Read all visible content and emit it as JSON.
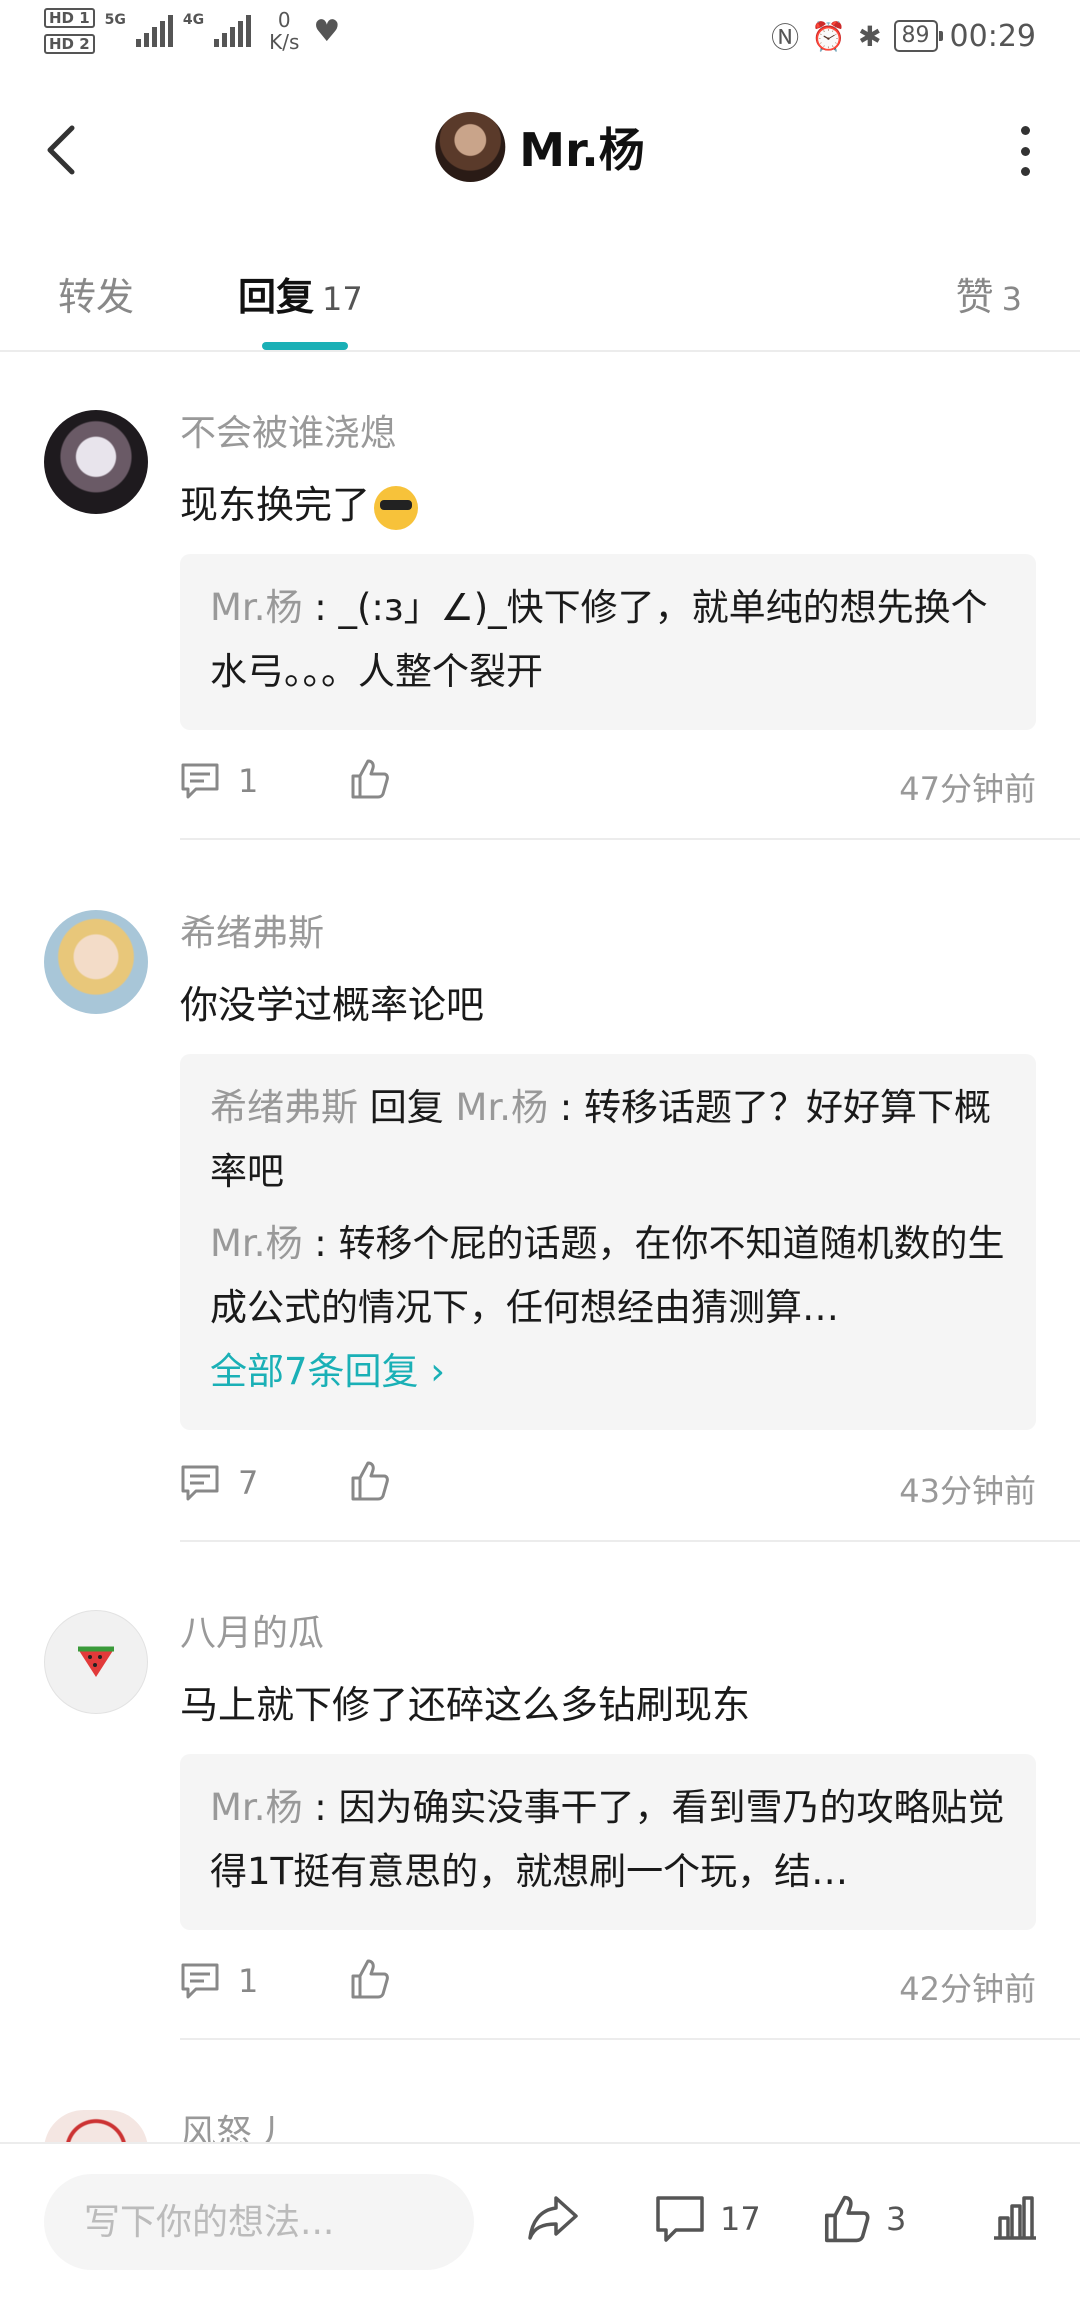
{
  "status_bar": {
    "hd1": "HD 1",
    "hd2": "HD 2",
    "network": "5G",
    "network2": "4G",
    "speed_value": "0",
    "speed_unit": "K/s",
    "battery": "89",
    "time": "00:29"
  },
  "header": {
    "title": "Mr.杨"
  },
  "tabs": [
    {
      "label": "转发",
      "count": ""
    },
    {
      "label": "回复",
      "count": "17"
    },
    {
      "label": "赞",
      "count": "3"
    }
  ],
  "comments": [
    {
      "name": "不会被谁浇熄",
      "text": "现东换完了",
      "quote": {
        "lines": [
          {
            "name": "Mr.杨",
            "text": " : _(:з」∠)_快下修了，就单纯的想先换个水弓。。。人整个裂开"
          }
        ]
      },
      "comment_count": "1",
      "time": "47分钟前"
    },
    {
      "name": "希绪弗斯",
      "text": "你没学过概率论吧",
      "quote": {
        "lines": [
          {
            "name": "希绪弗斯",
            "reply_word": " 回复 ",
            "reply_to": "Mr.杨",
            "text": " : 转移话题了？好好算下概率吧"
          },
          {
            "name": "Mr.杨",
            "text": " : 转移个屁的话题，在你不知道随机数的生成公式的情况下，任何想经由猜测算…"
          }
        ],
        "more": "全部7条回复 ›"
      },
      "comment_count": "7",
      "time": "43分钟前"
    },
    {
      "name": "八月的瓜",
      "text": "马上就下修了还碎这么多钻刷现东",
      "quote": {
        "lines": [
          {
            "name": "Mr.杨",
            "text": " : 因为确实没事干了，看到雪乃的攻略贴觉得1T挺有意思的，就想刷一个玩，结…"
          }
        ]
      },
      "comment_count": "1",
      "time": "42分钟前"
    },
    {
      "name": "风怒丿"
    }
  ],
  "bottom_bar": {
    "input_placeholder": "写下你的想法...",
    "comment_count": "17",
    "like_count": "3"
  },
  "colors": {
    "accent": "#1ab0b6",
    "muted": "#999999",
    "quote_bg": "#f5f5f5"
  }
}
